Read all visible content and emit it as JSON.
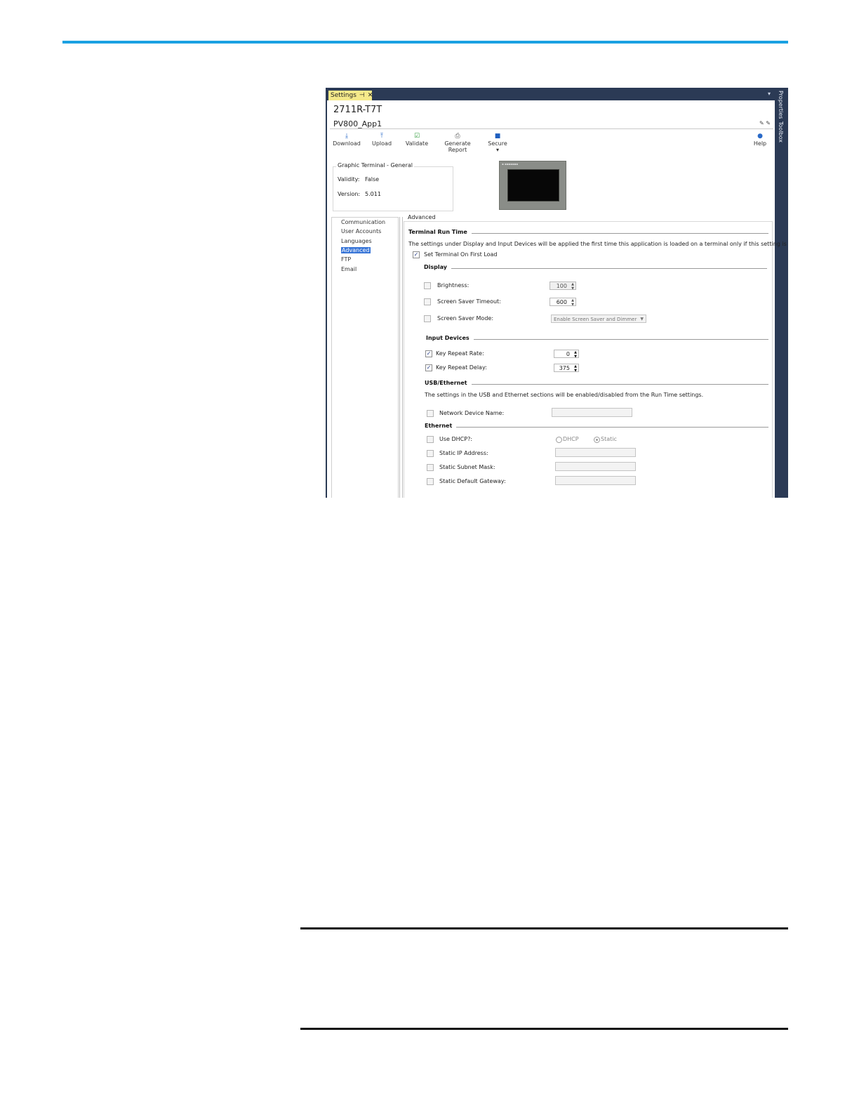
{
  "window": {
    "tab_label": "Settings",
    "tab_pin": "⊣",
    "tab_close": "✕",
    "side_tabs": [
      "Properties",
      "Toolbox"
    ],
    "dropdown_glyph": "▾"
  },
  "header": {
    "terminal_model": "2711R-T7T",
    "app_name": "PV800_App1"
  },
  "toolbar": {
    "download": "Download",
    "upload": "Upload",
    "validate": "Validate",
    "generate_report": "Generate Report",
    "secure": "Secure ▾",
    "help": "Help"
  },
  "general": {
    "title": "Graphic Terminal - General",
    "validity_label": "Validity:",
    "validity_value": "False",
    "version_label": "Version:",
    "version_value": "5.011"
  },
  "nav": {
    "items": [
      "Communication",
      "User Accounts",
      "Languages",
      "Advanced",
      "FTP",
      "Email"
    ],
    "selected": "Advanced"
  },
  "advanced": {
    "title": "Advanced",
    "terminal_run_time": {
      "heading": "Terminal Run Time",
      "note": "The settings under Display and Input Devices will be applied the first time this application is loaded on a terminal only if this setting is checked.",
      "set_terminal_label": "Set Terminal On First Load",
      "set_terminal_checked": true
    },
    "display": {
      "heading": "Display",
      "brightness_label": "Brightness:",
      "brightness_value": "100",
      "brightness_checked": false,
      "screensaver_timeout_label": "Screen Saver Timeout:",
      "screensaver_timeout_value": "600",
      "screensaver_timeout_checked": false,
      "screensaver_mode_label": "Screen Saver Mode:",
      "screensaver_mode_value": "Enable Screen Saver and Dimmer",
      "screensaver_mode_checked": false
    },
    "input_devices": {
      "heading": "Input Devices",
      "key_repeat_rate_label": "Key Repeat Rate:",
      "key_repeat_rate_value": "0",
      "key_repeat_rate_checked": true,
      "key_repeat_delay_label": "Key Repeat Delay:",
      "key_repeat_delay_value": "375",
      "key_repeat_delay_checked": true
    },
    "usb_ethernet": {
      "heading": "USB/Ethernet",
      "note": "The settings in the USB and Ethernet sections will be enabled/disabled from the Run Time settings.",
      "network_device_name_label": "Network Device Name:",
      "network_device_name_value": "",
      "network_device_name_checked": false
    },
    "ethernet": {
      "heading": "Ethernet",
      "use_dhcp_label": "Use DHCP?:",
      "use_dhcp_checked": false,
      "dhcp_option": "DHCP",
      "static_option": "Static",
      "selected_option": "Static",
      "static_ip_label": "Static IP Address:",
      "static_ip_value": "",
      "static_subnet_label": "Static Subnet Mask:",
      "static_subnet_value": "",
      "static_gateway_label": "Static Default Gateway:",
      "static_gateway_value": ""
    }
  },
  "colors": {
    "accent_line": "#1ba1e2",
    "frame": "#2b3a55",
    "tab": "#f5e98a",
    "selection": "#3875d7"
  }
}
